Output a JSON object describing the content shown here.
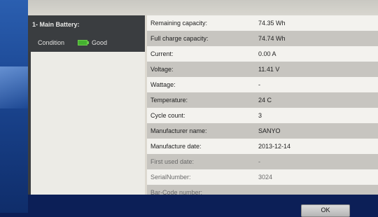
{
  "battery": {
    "header": "1- Main Battery:",
    "condition_label": "Condition",
    "condition_value": "Good",
    "status_color": "#44b030"
  },
  "details": [
    {
      "label": "Remaining capacity:",
      "value": "74.35 Wh"
    },
    {
      "label": "Full charge capacity:",
      "value": "74.74 Wh"
    },
    {
      "label": "Current:",
      "value": "0.00 A"
    },
    {
      "label": "Voltage:",
      "value": "11.41 V"
    },
    {
      "label": "Wattage:",
      "value": "-"
    },
    {
      "label": "Temperature:",
      "value": "24 C"
    },
    {
      "label": "Cycle count:",
      "value": "3"
    },
    {
      "label": "Manufacturer name:",
      "value": "SANYO"
    },
    {
      "label": "Manufacture date:",
      "value": "2013-12-14"
    },
    {
      "label": "First used date:",
      "value": "-"
    },
    {
      "label": "SerialNumber:",
      "value": "3024"
    },
    {
      "label": "Bar-Code number:",
      "value": ""
    }
  ],
  "footer": {
    "ok_label": "OK"
  }
}
